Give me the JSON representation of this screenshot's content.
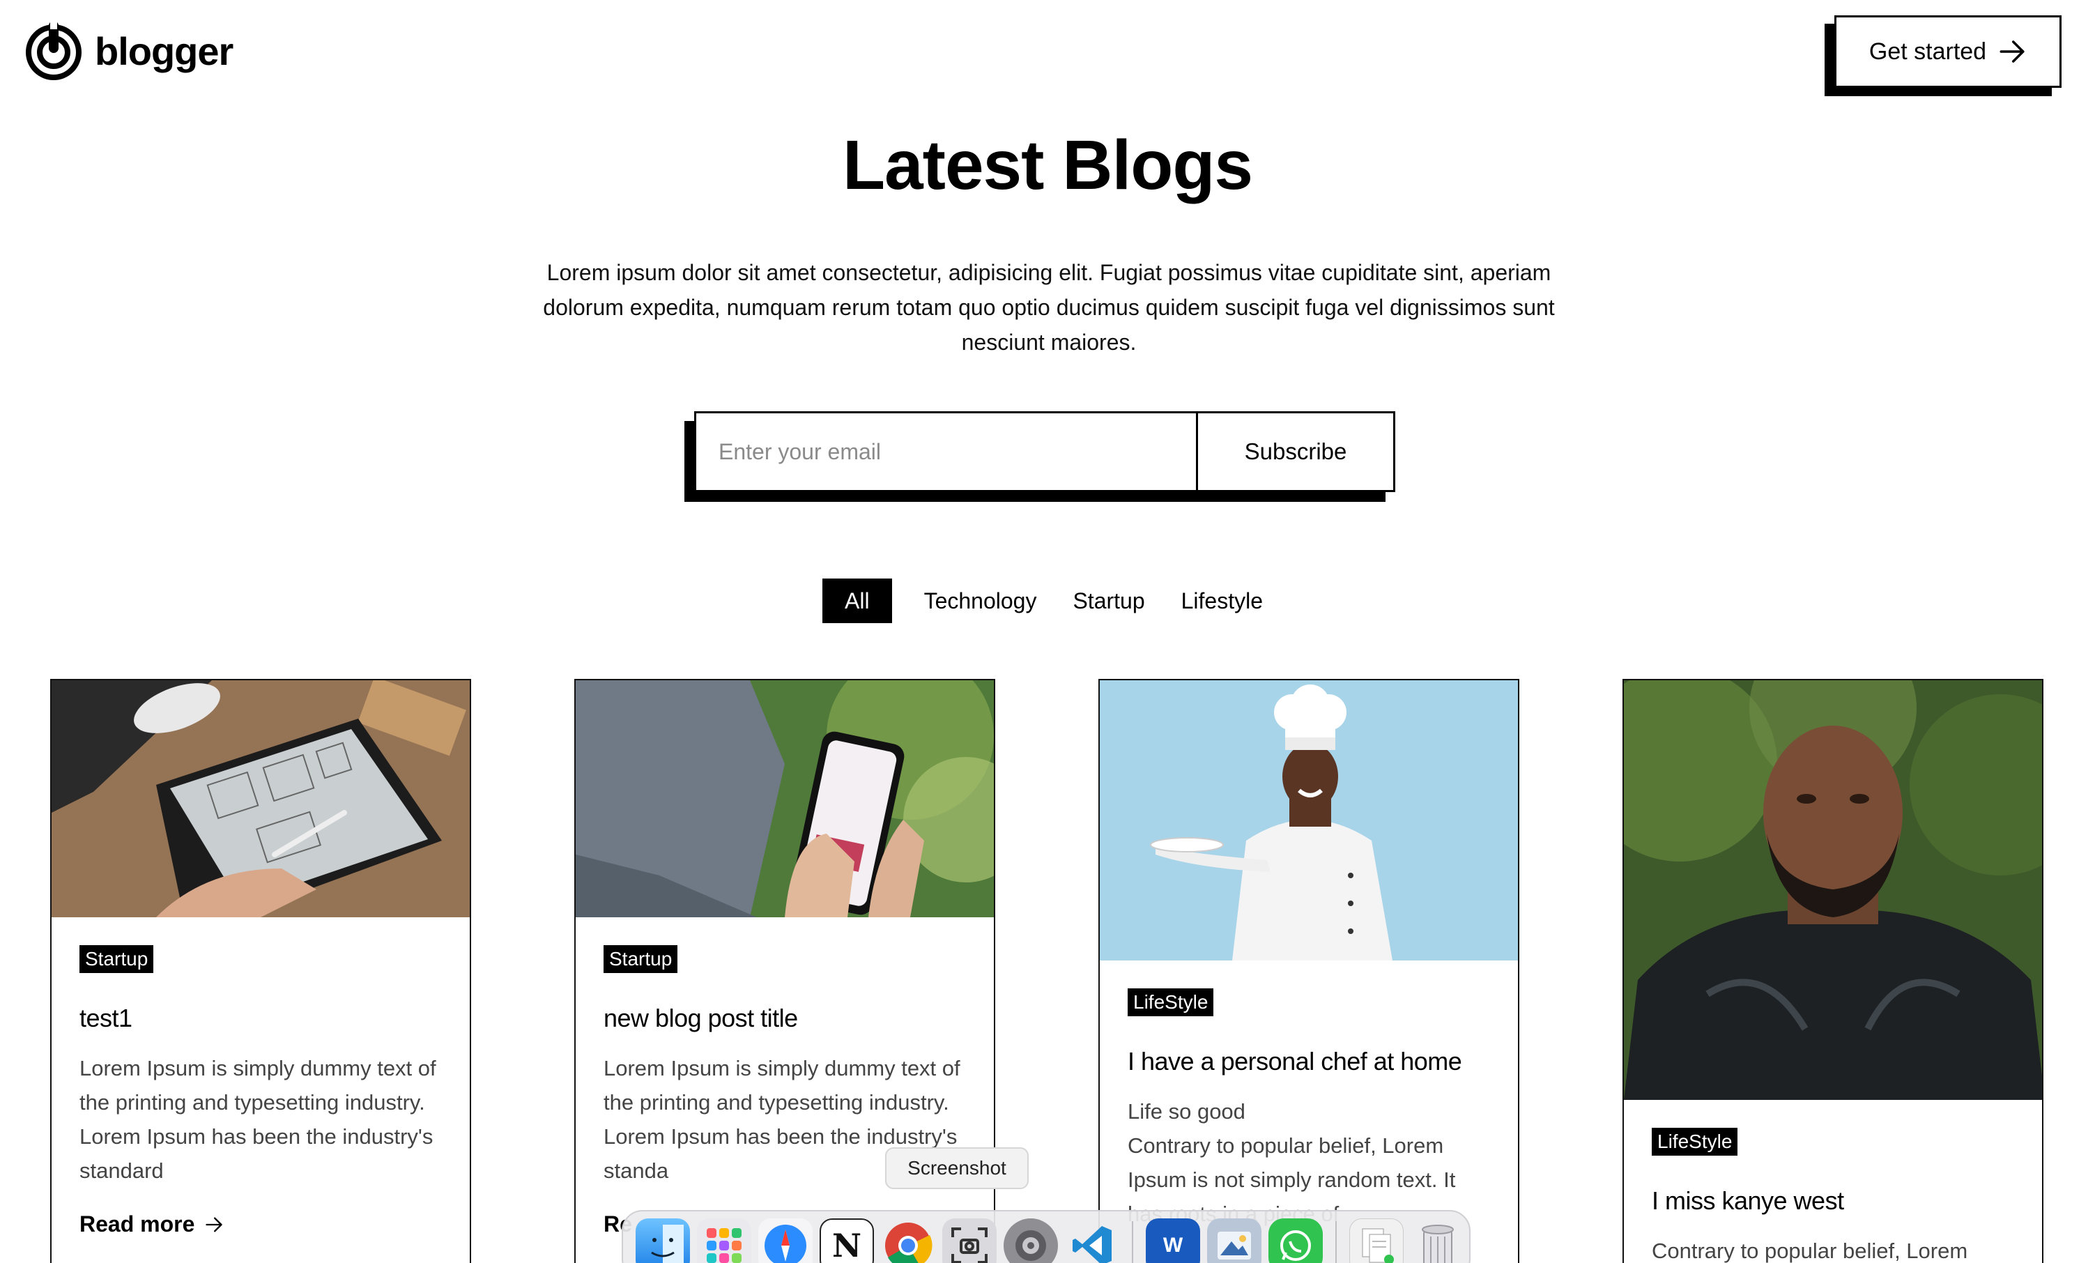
{
  "brand": {
    "name": "blogger"
  },
  "header": {
    "cta_label": "Get started"
  },
  "hero": {
    "title": "Latest Blogs",
    "description": "Lorem ipsum dolor sit amet consectetur, adipisicing elit. Fugiat possimus vitae cupiditate sint, aperiam dolorum expedita, numquam rerum totam quo optio ducimus quidem suscipit fuga vel dignissimos sunt nesciunt maiores."
  },
  "subscribe": {
    "placeholder": "Enter your email",
    "button_label": "Subscribe"
  },
  "filters": [
    "All",
    "Technology",
    "Startup",
    "Lifestyle"
  ],
  "cards": [
    {
      "tag": "Startup",
      "title": "test1",
      "text": "Lorem Ipsum is simply dummy text of the printing and typesetting industry. Lorem Ipsum has been the industry's standard",
      "read_more": "Read more"
    },
    {
      "tag": "Startup",
      "title": "new blog post title",
      "text": "Lorem Ipsum is simply dummy text of the printing and typesetting industry. Lorem Ipsum has been the industry's standa",
      "read_more": "Re"
    },
    {
      "tag": "LifeStyle",
      "title": "I have a personal chef at home",
      "text": "Life so good\nContrary to popular belief, Lorem Ipsum is not simply random text. It has roots in a piece of"
    },
    {
      "tag": "LifeStyle",
      "title": "I miss kanye west",
      "text": "Contrary to popular belief, Lorem"
    }
  ],
  "dock": {
    "tooltip": "Screenshot",
    "apps": [
      "finder-icon",
      "launchpad-icon",
      "safari-icon",
      "notion-icon",
      "chrome-icon",
      "screenshot-icon",
      "system-settings-icon",
      "vscode-icon",
      "word-icon",
      "preview-icon",
      "whatsapp-icon",
      "documents-icon",
      "trash-icon"
    ]
  }
}
